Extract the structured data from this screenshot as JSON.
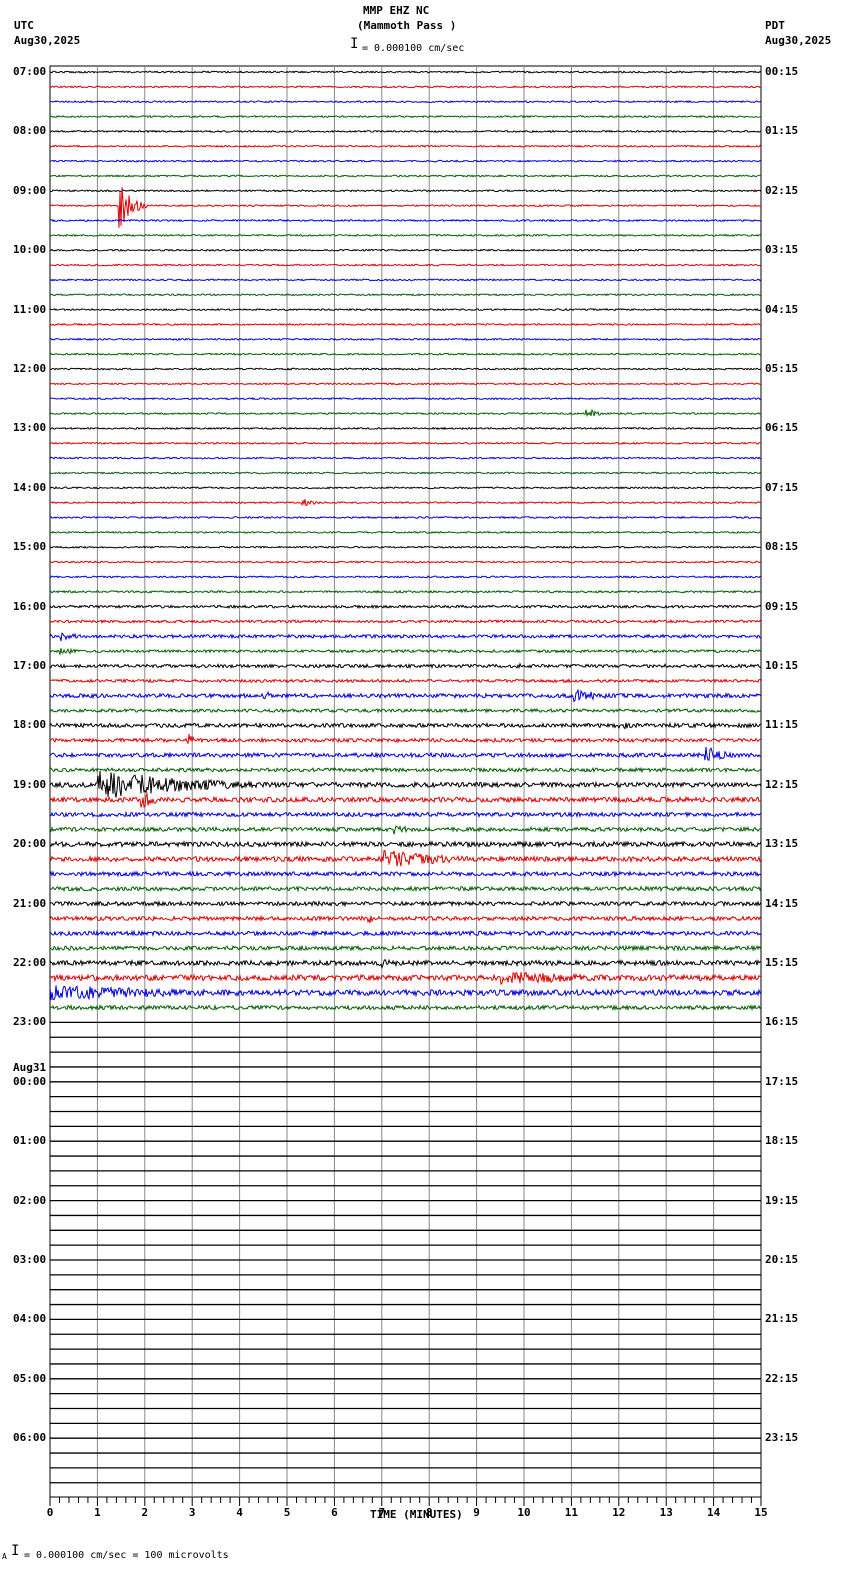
{
  "header": {
    "station": "MMP EHZ NC",
    "location": "(Mammoth Pass )",
    "left_tz": "UTC",
    "left_date": "Aug30,2025",
    "right_tz": "PDT",
    "right_date": "Aug30,2025",
    "scale_text": "= 0.000100 cm/sec"
  },
  "footer": {
    "scale_text": "= 0.000100 cm/sec =     100 microvolts",
    "prefix": "A"
  },
  "chart_data": {
    "type": "line",
    "title": "MMP EHZ NC (Mammoth Pass )",
    "xlabel": "TIME (MINUTES)",
    "xlim": [
      0,
      15
    ],
    "x_ticks": [
      "0",
      "1",
      "2",
      "3",
      "4",
      "5",
      "6",
      "7",
      "8",
      "9",
      "10",
      "11",
      "12",
      "13",
      "14",
      "15"
    ],
    "traces_per_hour": 4,
    "trace_colors": [
      "#000000",
      "#e00000",
      "#0000e0",
      "#006000"
    ],
    "left_labels": [
      "07:00",
      "08:00",
      "09:00",
      "10:00",
      "11:00",
      "12:00",
      "13:00",
      "14:00",
      "15:00",
      "16:00",
      "17:00",
      "18:00",
      "19:00",
      "20:00",
      "21:00",
      "22:00",
      "23:00",
      "00:00",
      "01:00",
      "02:00",
      "03:00",
      "04:00",
      "05:00",
      "06:00"
    ],
    "date_change_label": "Aug31",
    "right_labels": [
      "00:15",
      "01:15",
      "02:15",
      "03:15",
      "04:15",
      "05:15",
      "06:15",
      "07:15",
      "08:15",
      "09:15",
      "10:15",
      "11:15",
      "12:15",
      "13:15",
      "14:15",
      "15:15",
      "16:15",
      "17:15",
      "18:15",
      "19:15",
      "20:15",
      "21:15",
      "22:15",
      "23:15"
    ],
    "recorded_traces": 64,
    "noise_levels": [
      1,
      1,
      1,
      1,
      1,
      1,
      1,
      1,
      1,
      1,
      1,
      1,
      1,
      1,
      1,
      1,
      1,
      1,
      1,
      1,
      1,
      1,
      1,
      1,
      1,
      1,
      1,
      1,
      1,
      1,
      1,
      1,
      1,
      1,
      1,
      1.2,
      1.6,
      1.6,
      2,
      1.6,
      2,
      1.8,
      2.5,
      2,
      2.5,
      2.2,
      2.5,
      2.2,
      3,
      3,
      2.5,
      2.5,
      3,
      3,
      2.5,
      2.5,
      2.5,
      2.5,
      2.5,
      2.5,
      3,
      3.5,
      3.5,
      2.5
    ],
    "events": [
      {
        "trace": 9,
        "minute": 1.45,
        "duration": 0.6,
        "amplitude": 28
      },
      {
        "trace": 23,
        "minute": 11.3,
        "duration": 0.6,
        "amplitude": 6
      },
      {
        "trace": 29,
        "minute": 5.3,
        "duration": 0.6,
        "amplitude": 5
      },
      {
        "trace": 38,
        "minute": 0.2,
        "duration": 0.8,
        "amplitude": 6
      },
      {
        "trace": 39,
        "minute": 0.2,
        "duration": 0.8,
        "amplitude": 5
      },
      {
        "trace": 40,
        "minute": 9.8,
        "duration": 0.5,
        "amplitude": 5
      },
      {
        "trace": 42,
        "minute": 11.0,
        "duration": 1.5,
        "amplitude": 8
      },
      {
        "trace": 42,
        "minute": 4.5,
        "duration": 1.2,
        "amplitude": 5
      },
      {
        "trace": 44,
        "minute": 12.0,
        "duration": 0.5,
        "amplitude": 7
      },
      {
        "trace": 45,
        "minute": 2.9,
        "duration": 0.3,
        "amplitude": 9
      },
      {
        "trace": 46,
        "minute": 13.8,
        "duration": 1.0,
        "amplitude": 10
      },
      {
        "trace": 48,
        "minute": 1.0,
        "duration": 5.0,
        "amplitude": 16
      },
      {
        "trace": 49,
        "minute": 1.9,
        "duration": 0.8,
        "amplitude": 10
      },
      {
        "trace": 51,
        "minute": 7.2,
        "duration": 1.0,
        "amplitude": 6
      },
      {
        "trace": 53,
        "minute": 7.0,
        "duration": 3.5,
        "amplitude": 10
      },
      {
        "trace": 57,
        "minute": 6.7,
        "duration": 0.3,
        "amplitude": 7
      },
      {
        "trace": 60,
        "minute": 7.0,
        "duration": 1.0,
        "amplitude": 6
      },
      {
        "trace": 61,
        "minute": 9.5,
        "duration": 5.5,
        "amplitude": 7
      },
      {
        "trace": 62,
        "minute": 0.0,
        "duration": 8.5,
        "amplitude": 8
      }
    ]
  }
}
